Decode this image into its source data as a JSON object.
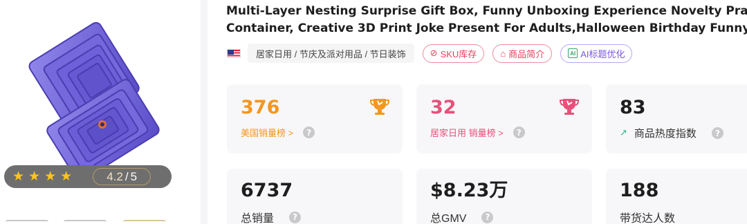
{
  "product": {
    "title_line1": "Multi-Layer Nesting Surprise Gift Box, Funny Unboxing Experience Novelty Prank",
    "title_line2": "Container, Creative 3D Print Joke Present For Adults,Halloween Birthday Funny Gift",
    "country_flag_icon": "us-flag-icon",
    "category": "居家日用 / 节庆及派对用品 / 节日装饰",
    "rating_value": "4.2",
    "rating_sep": "/",
    "rating_max": "5",
    "stars": 4
  },
  "buttons": {
    "sku": "SKU库存",
    "intro": "商品简介",
    "ai_title": "AI标题优化"
  },
  "stats": {
    "us_rank": {
      "value": "376",
      "label": "美国销量榜 >"
    },
    "cat_rank": {
      "value": "32",
      "label": "居家日用 销量榜 >"
    },
    "heat": {
      "value": "83",
      "label": "商品热度指数"
    },
    "total_sales": {
      "value": "6737",
      "label": "总销量"
    },
    "gmv": {
      "value": "$8.23万",
      "label": "总GMV"
    },
    "influencers": {
      "value": "188",
      "label": "带货达人数"
    }
  },
  "icons": {
    "help": "?",
    "trend": "trend-up-icon",
    "trophy": "trophy-icon"
  },
  "colors": {
    "orange": "#f49620",
    "pink": "#e8507a",
    "purple": "#7a55e6",
    "green": "#2bb686"
  }
}
